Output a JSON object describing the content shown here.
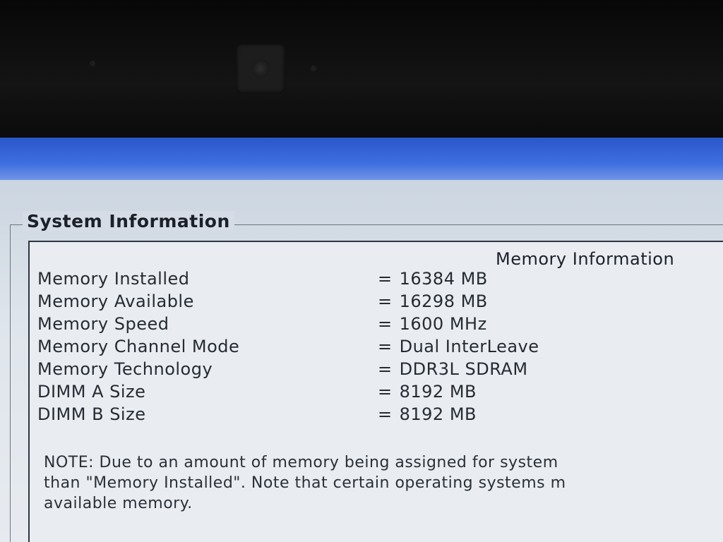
{
  "bezel": {
    "webcam_icon": "webcam-icon"
  },
  "group": {
    "title": "System Information"
  },
  "panel": {
    "heading": "Memory Information",
    "rows": [
      {
        "label": "Memory Installed",
        "value": "16384 MB"
      },
      {
        "label": "Memory Available",
        "value": "16298 MB"
      },
      {
        "label": "Memory Speed",
        "value": "1600 MHz"
      },
      {
        "label": "Memory Channel Mode",
        "value": "Dual InterLeave"
      },
      {
        "label": "Memory Technology",
        "value": "DDR3L SDRAM"
      },
      {
        "label": "DIMM A Size",
        "value": "8192 MB"
      },
      {
        "label": "DIMM B Size",
        "value": "8192 MB"
      }
    ],
    "separator": "=",
    "note_lines": [
      "NOTE: Due to an amount of memory being assigned for system",
      "than \"Memory Installed\". Note that certain operating systems m",
      "available memory."
    ]
  },
  "colors": {
    "title_strip": "#2a57c9",
    "panel_bg": "#e9edf1",
    "text": "#262b33"
  }
}
